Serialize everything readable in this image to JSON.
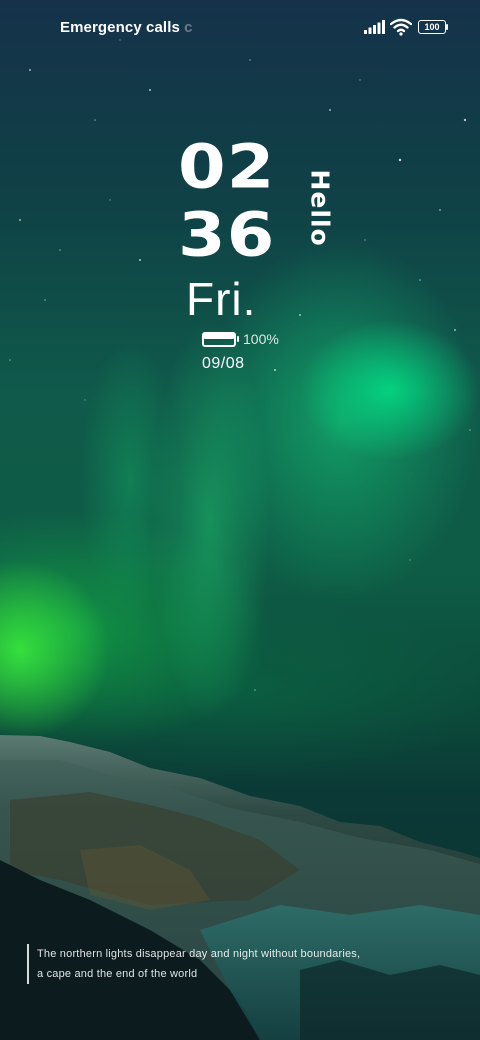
{
  "status_bar": {
    "carrier_text": "Emergency calls",
    "carrier_text_fade": " c",
    "battery_level": "100",
    "icons": [
      "signal-icon",
      "wifi-icon",
      "battery-icon"
    ]
  },
  "lockscreen": {
    "clock": {
      "hours": "02",
      "minutes": "36"
    },
    "greeting": "Hello",
    "weekday": "Fri.",
    "battery": {
      "percent_text": "100%",
      "level": 1.0
    },
    "date": "09/08"
  },
  "wallpaper": {
    "caption_lines": [
      "The northern lights disappear day and night without boundaries,",
      "a cape and the end of the world"
    ]
  },
  "colors": {
    "sky_top": "#15324a",
    "aurora_green": "#00eb8c",
    "aurora_lime": "#3cf03c",
    "text": "#ffffff"
  }
}
